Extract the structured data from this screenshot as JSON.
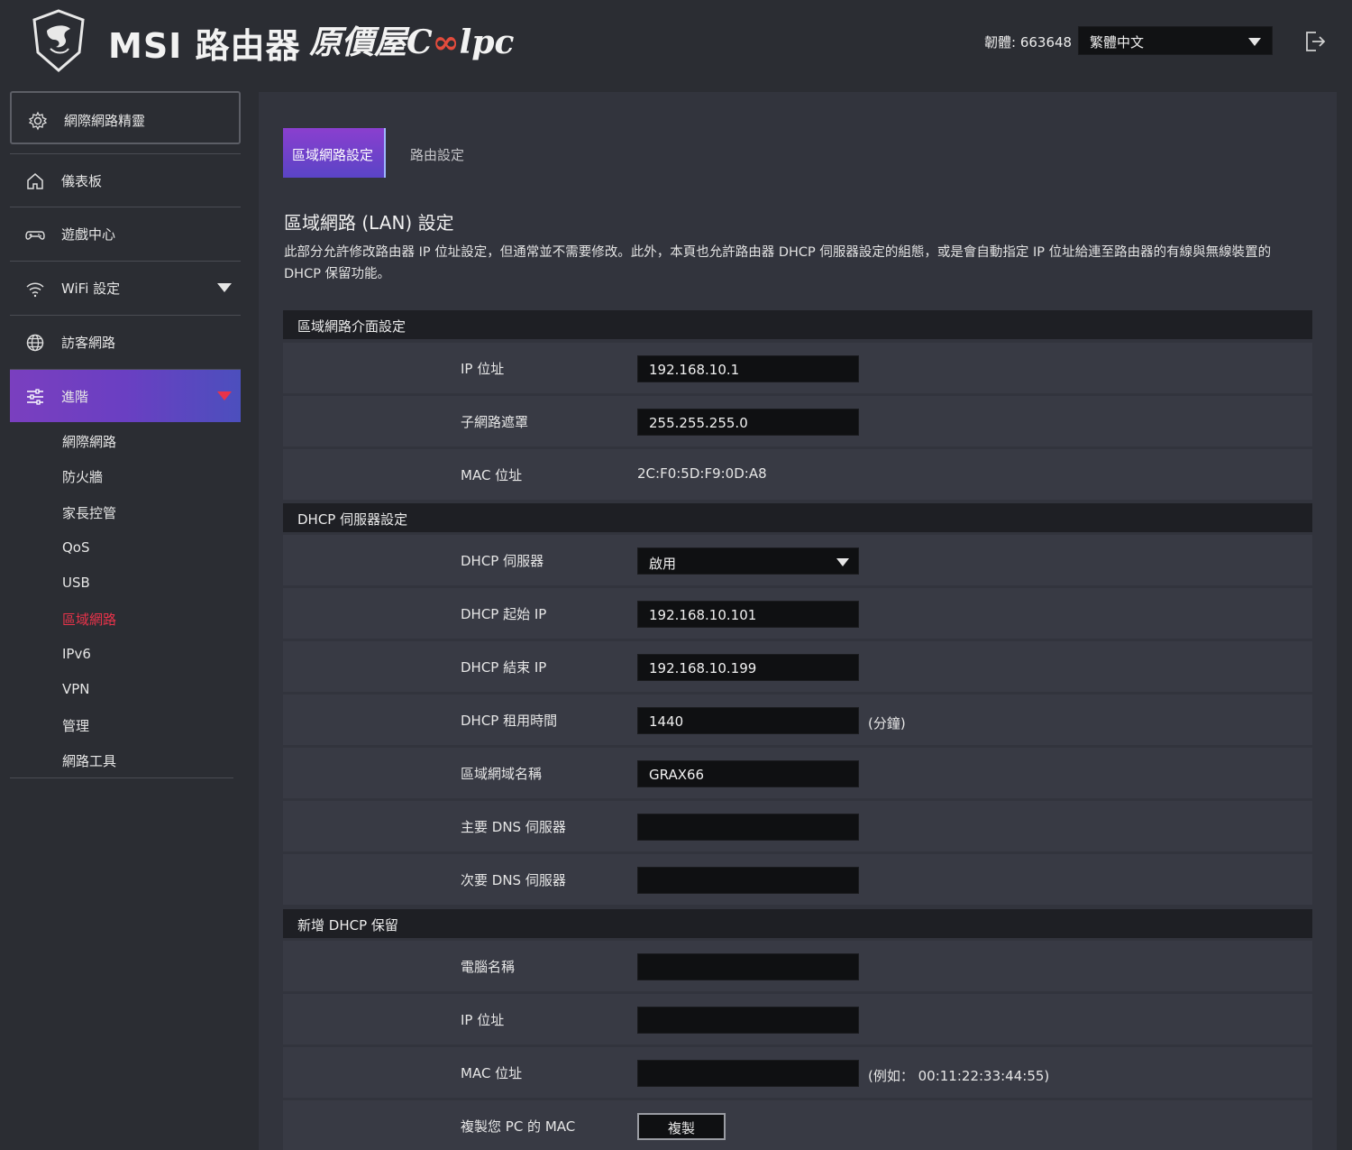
{
  "header": {
    "brand": "MSI 路由器",
    "partner_prefix": "原價屋",
    "partner_c": "C",
    "partner_oo": "∞",
    "partner_suffix": "lpc",
    "firmware": "韌體: 663648",
    "language": "繁體中文"
  },
  "sidebar": {
    "wizard": "網際網路精靈",
    "items": [
      {
        "label": "儀表板",
        "icon": "home-icon"
      },
      {
        "label": "遊戲中心",
        "icon": "gamepad-icon"
      },
      {
        "label": "WiFi 設定",
        "icon": "wifi-icon"
      },
      {
        "label": "訪客網路",
        "icon": "globe-icon"
      },
      {
        "label": "進階",
        "icon": "sliders-icon"
      }
    ],
    "sub_items": [
      "網際網路",
      "防火牆",
      "家長控管",
      "QoS",
      "USB",
      "區域網路",
      "IPv6",
      "VPN",
      "管理",
      "網路工具"
    ]
  },
  "tabs": {
    "active": "區域網路設定",
    "inactive": "路由設定"
  },
  "page": {
    "title": "區域網路 (LAN) 設定",
    "description": "此部分允許修改路由器 IP 位址設定，但通常並不需要修改。此外，本頁也允許路由器 DHCP 伺服器設定的組態，或是會自動指定 IP 位址給連至路由器的有線與無線裝置的 DHCP 保留功能。"
  },
  "lan_section": {
    "title": "區域網路介面設定",
    "ip_label": "IP 位址",
    "ip_value": "192.168.10.1",
    "subnet_label": "子網路遮罩",
    "subnet_value": "255.255.255.0",
    "mac_label": "MAC 位址",
    "mac_value": "2C:F0:5D:F9:0D:A8"
  },
  "dhcp_section": {
    "title": "DHCP 伺服器設定",
    "server_label": "DHCP 伺服器",
    "server_value": "啟用",
    "start_label": "DHCP 起始 IP",
    "start_value": "192.168.10.101",
    "end_label": "DHCP 結束 IP",
    "end_value": "192.168.10.199",
    "lease_label": "DHCP 租用時間",
    "lease_value": "1440",
    "lease_unit": "(分鐘)",
    "domain_label": "區域網域名稱",
    "domain_value": "GRAX66",
    "dns1_label": "主要 DNS 伺服器",
    "dns1_value": "",
    "dns2_label": "次要 DNS 伺服器",
    "dns2_value": ""
  },
  "reserve_section": {
    "title": "新增 DHCP 保留",
    "pc_name_label": "電腦名稱",
    "ip_label": "IP 位址",
    "mac_label": "MAC 位址",
    "mac_hint": "(例如： 00:11:22:33:44:55)",
    "copy_label": "複製您 PC 的 MAC",
    "copy_button": "複製"
  }
}
